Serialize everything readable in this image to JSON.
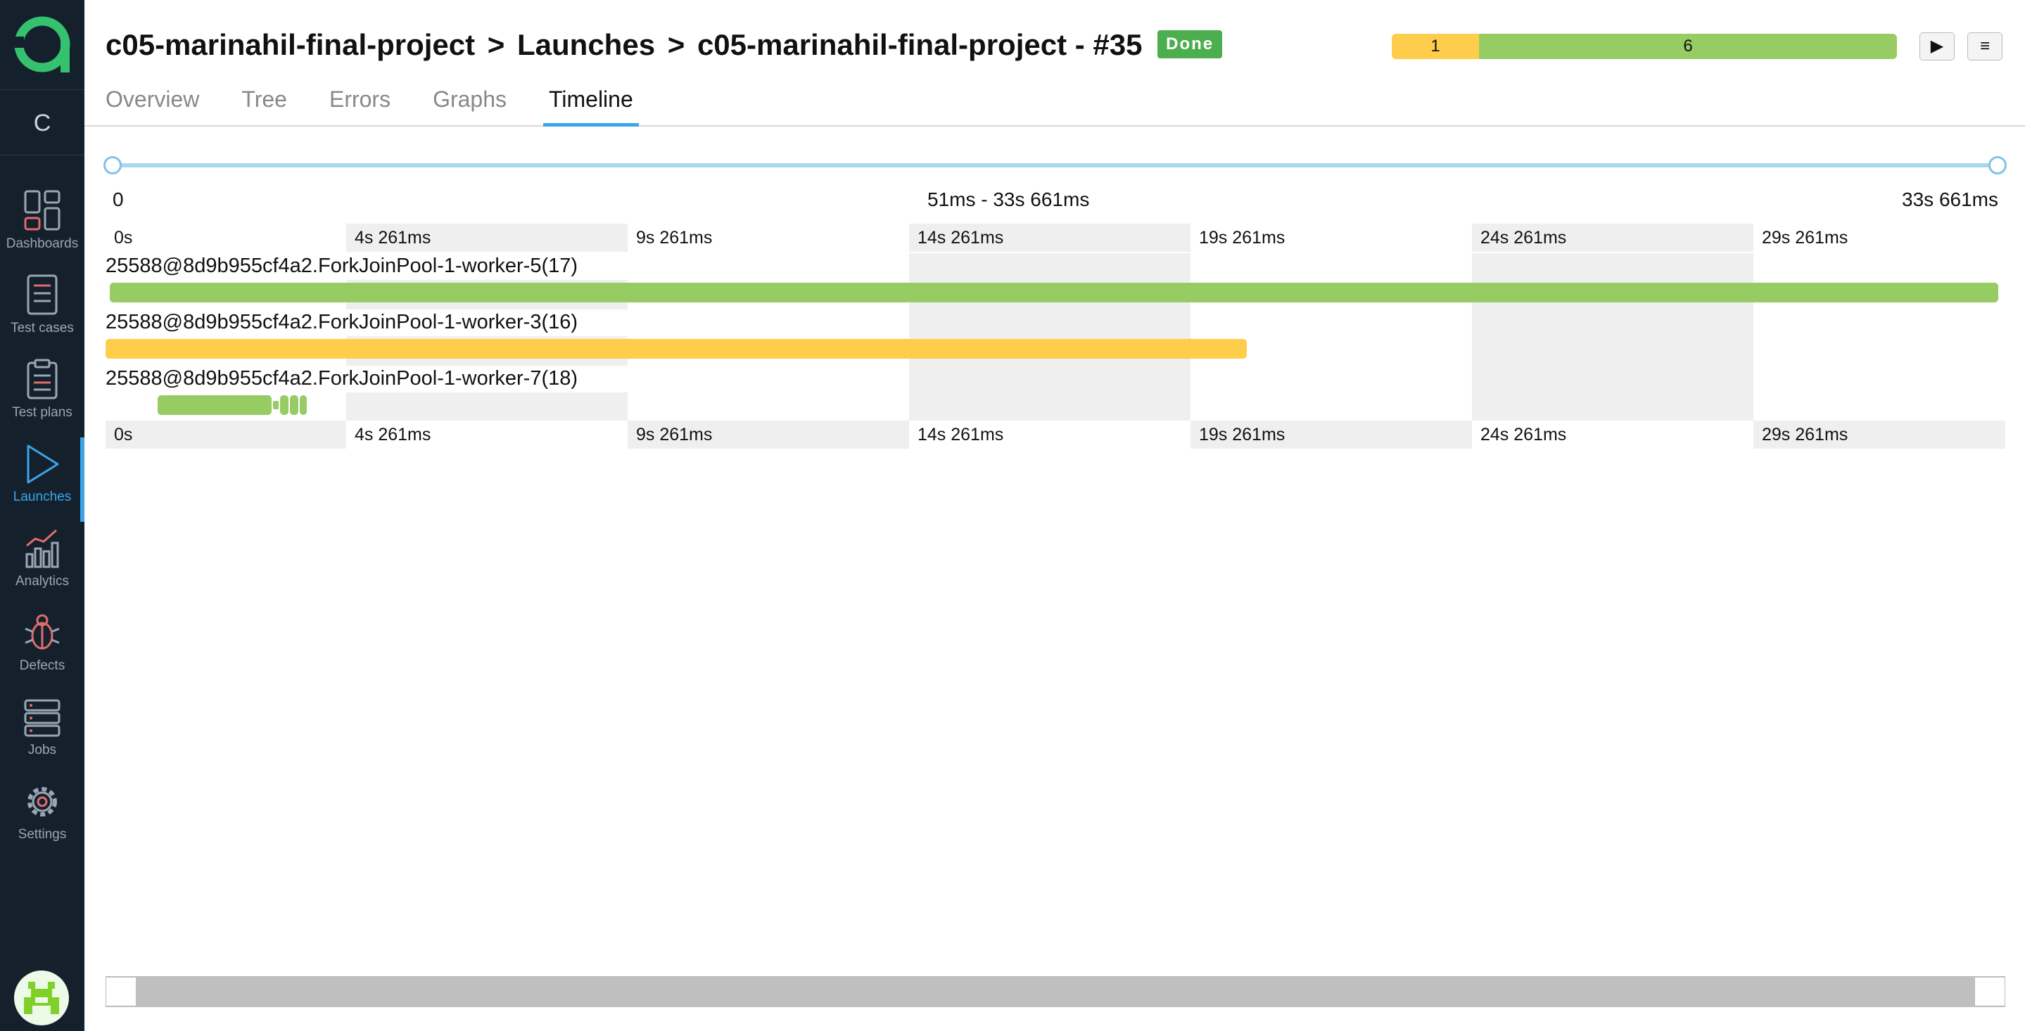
{
  "app": {
    "project_initial": "C"
  },
  "sidebar": {
    "items": [
      {
        "label": "Dashboards",
        "icon": "dashboards-icon"
      },
      {
        "label": "Test cases",
        "icon": "test-cases-icon"
      },
      {
        "label": "Test plans",
        "icon": "test-plans-icon"
      },
      {
        "label": "Launches",
        "icon": "launches-icon",
        "active": true
      },
      {
        "label": "Analytics",
        "icon": "analytics-icon"
      },
      {
        "label": "Defects",
        "icon": "defects-icon"
      },
      {
        "label": "Jobs",
        "icon": "jobs-icon"
      },
      {
        "label": "Settings",
        "icon": "settings-icon"
      }
    ],
    "accent": "#3ba5e8"
  },
  "header": {
    "breadcrumb": {
      "project": "c05-marinahil-final-project",
      "separator": ">",
      "section": "Launches",
      "launch": "c05-marinahil-final-project - #35"
    },
    "status_badge": "Done",
    "stats": {
      "broken": "1",
      "passed": "6"
    },
    "play_button": "▶",
    "menu_button": "≡"
  },
  "tabs": [
    "Overview",
    "Tree",
    "Errors",
    "Graphs",
    "Timeline"
  ],
  "active_tab": "Timeline",
  "timeline": {
    "range": {
      "start": "0",
      "selection": "51ms - 33s 661ms",
      "end": "33s 661ms"
    },
    "ticks": [
      "0s",
      "4s 261ms",
      "9s 261ms",
      "14s 261ms",
      "19s 261ms",
      "24s 261ms",
      "29s 261ms"
    ],
    "threads": [
      {
        "label": "25588@8d9b955cf4a2.ForkJoinPool-1-worker-5(17)",
        "status": "passed"
      },
      {
        "label": "25588@8d9b955cf4a2.ForkJoinPool-1-worker-3(16)",
        "status": "broken"
      },
      {
        "label": "25588@8d9b955cf4a2.ForkJoinPool-1-worker-7(18)",
        "status": "passed"
      }
    ]
  },
  "colors": {
    "passed": "#97cc64",
    "broken": "#fdcd4b",
    "done_badge": "#4cae4f",
    "sidebar_bg": "#14212d"
  }
}
